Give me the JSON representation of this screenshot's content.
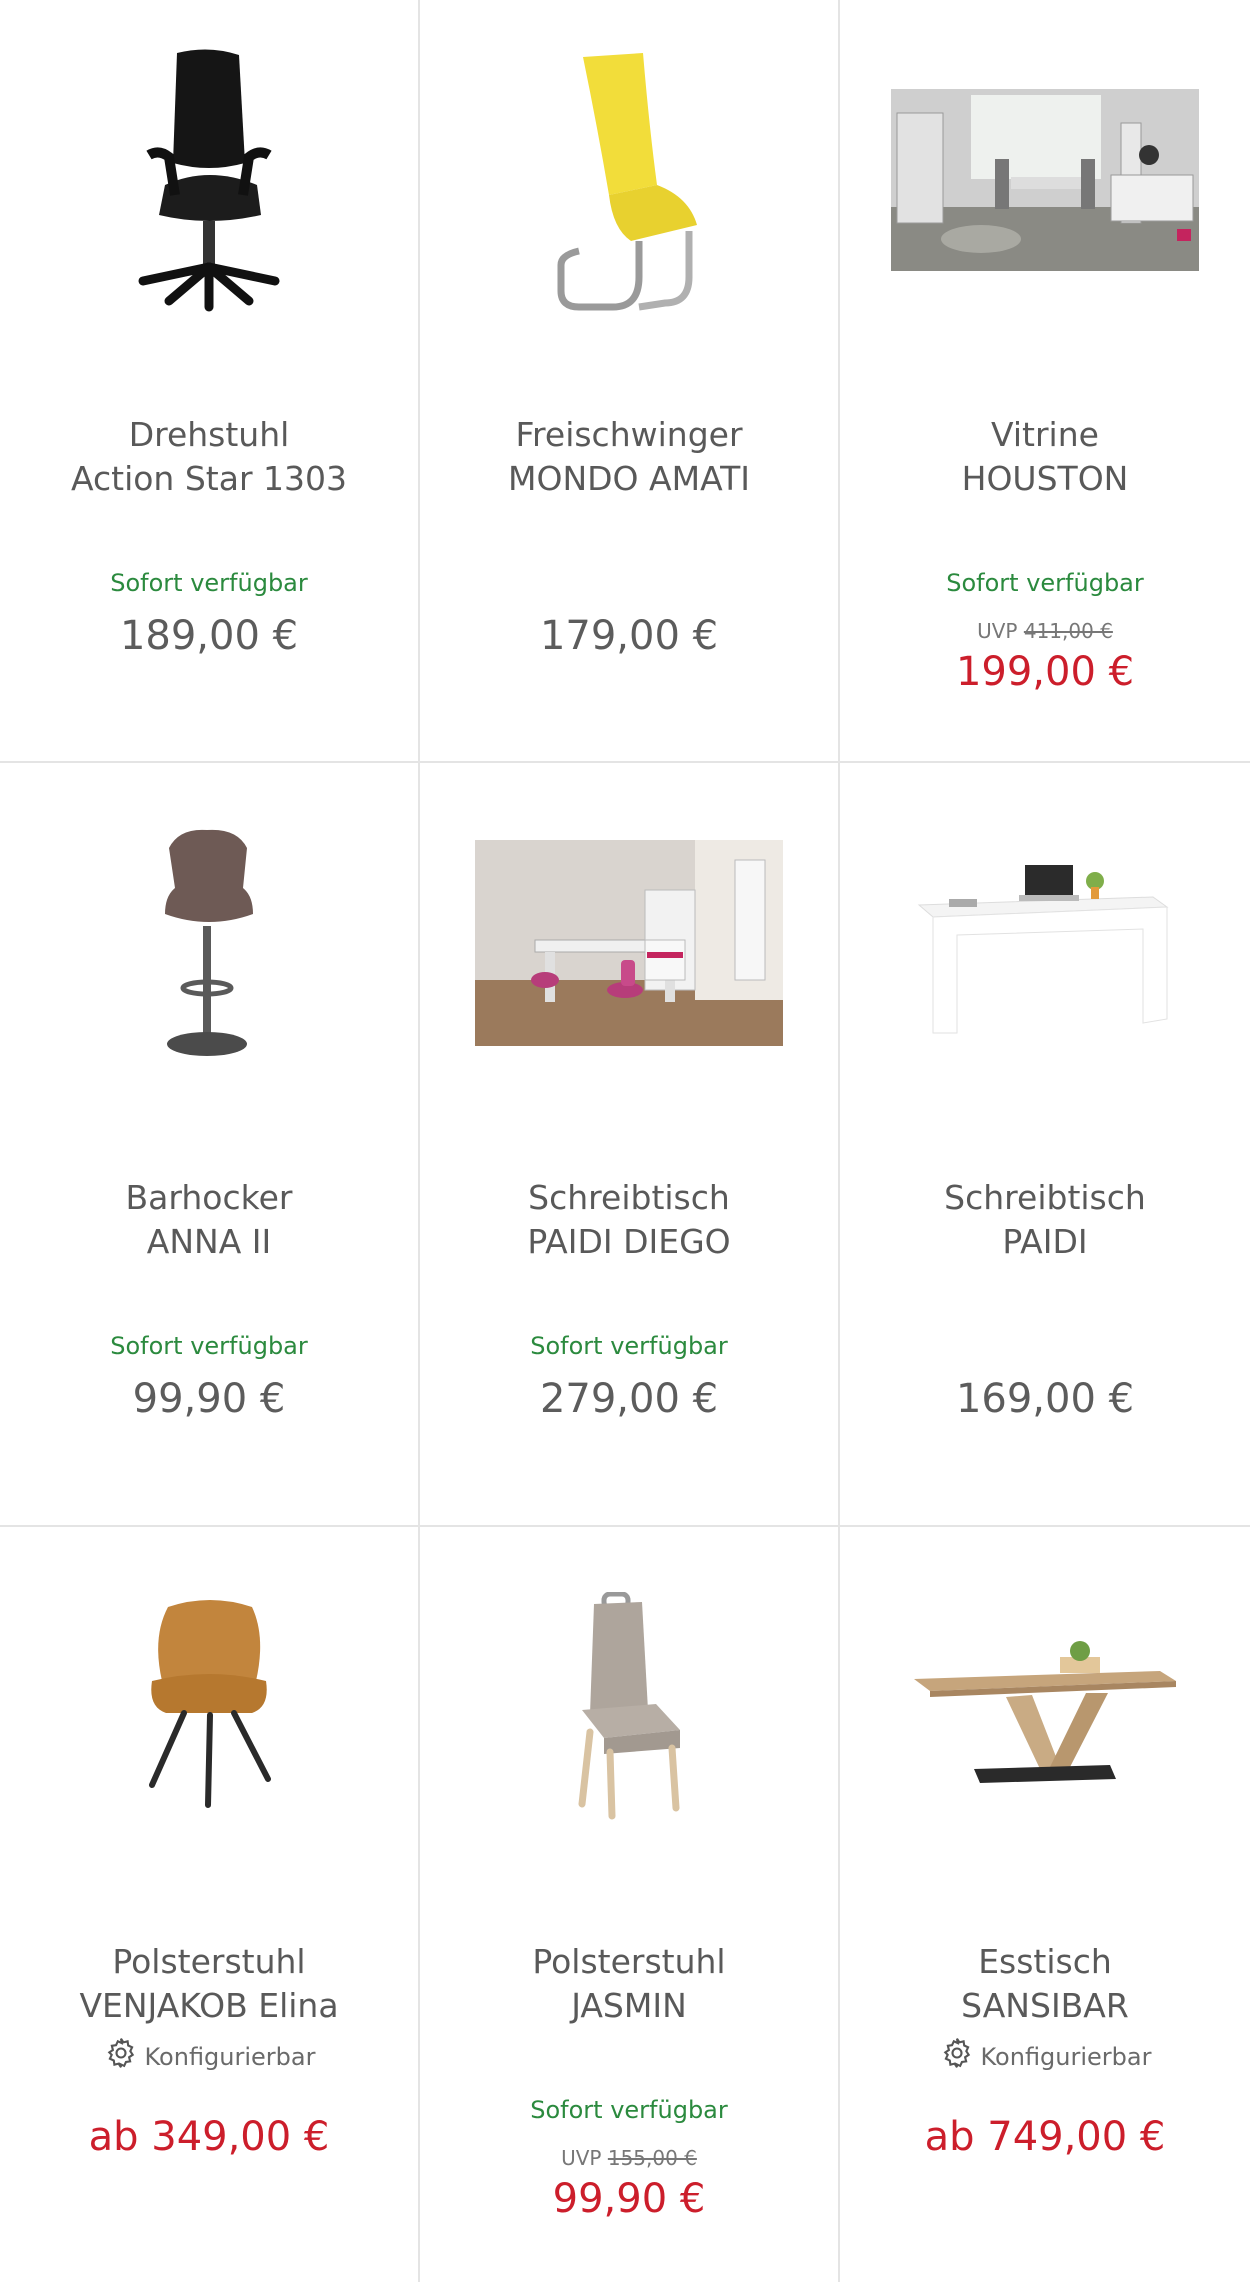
{
  "products": [
    {
      "title_line1": "Drehstuhl",
      "title_line2": "Action Star 1303",
      "availability": "Sofort verfügbar",
      "price": "189,00 €",
      "image_icon": "office-chair-image"
    },
    {
      "title_line1": "Freischwinger",
      "title_line2": "MONDO AMATI",
      "price": "179,00 €",
      "image_icon": "cantilever-chair-image"
    },
    {
      "title_line1": "Vitrine",
      "title_line2": "HOUSTON",
      "availability": "Sofort verfügbar",
      "uvp_label": "UVP",
      "uvp_price": "411,00 €",
      "sale_price": "199,00 €",
      "image_icon": "living-room-photo"
    },
    {
      "title_line1": "Barhocker",
      "title_line2": "ANNA II",
      "availability": "Sofort verfügbar",
      "price": "99,90 €",
      "image_icon": "bar-stool-image"
    },
    {
      "title_line1": "Schreibtisch",
      "title_line2": "PAIDI DIEGO",
      "availability": "Sofort verfügbar",
      "price": "279,00 €",
      "image_icon": "kids-room-photo"
    },
    {
      "title_line1": "Schreibtisch",
      "title_line2": "PAIDI",
      "price": "169,00 €",
      "image_icon": "white-desk-image"
    },
    {
      "title_line1": "Polsterstuhl",
      "title_line2": "VENJAKOB Elina",
      "config_label": "Konfigurierbar",
      "price": "ab 349,00 €",
      "image_icon": "upholstered-armchair-image"
    },
    {
      "title_line1": "Polsterstuhl",
      "title_line2": "JASMIN",
      "availability": "Sofort verfügbar",
      "uvp_label": "UVP",
      "uvp_price": "155,00 €",
      "sale_price": "99,90 €",
      "image_icon": "dining-chair-image"
    },
    {
      "title_line1": "Esstisch",
      "title_line2": "SANSIBAR",
      "config_label": "Konfigurierbar",
      "price": "ab 749,00 €",
      "image_icon": "dining-table-image"
    }
  ],
  "colors": {
    "availability": "#2b8a3e",
    "sale": "#cc1e2b",
    "text": "#595959",
    "divider": "#e4e4e4"
  }
}
